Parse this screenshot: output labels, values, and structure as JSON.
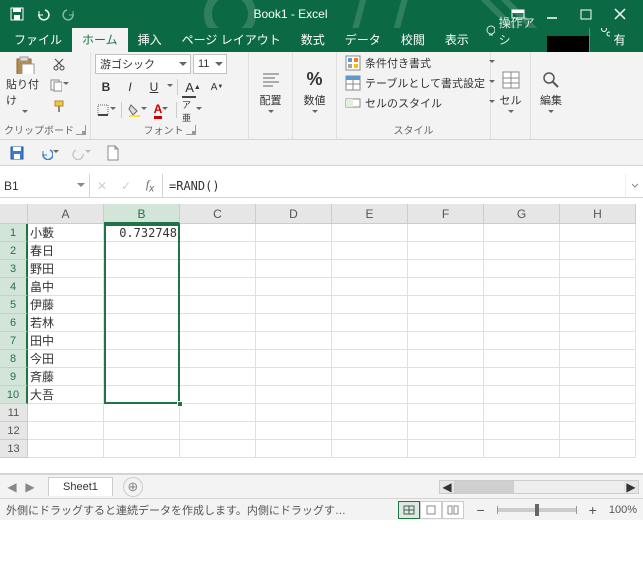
{
  "title": "Book1 - Excel",
  "tabs": {
    "file": "ファイル",
    "home": "ホーム",
    "insert": "挿入",
    "pagelayout": "ページ レイアウト",
    "formulas": "数式",
    "data": "データ",
    "review": "校閲",
    "view": "表示",
    "tellme": "操作アシ",
    "share": "共有"
  },
  "ribbon": {
    "clipboard": {
      "label": "クリップボード",
      "paste": "貼り付け"
    },
    "font": {
      "label": "フォント",
      "name": "游ゴシック",
      "size": "11",
      "bold": "B",
      "italic": "I",
      "underline": "U"
    },
    "alignment": {
      "label": "配置"
    },
    "number": {
      "label": "数値"
    },
    "styles": {
      "label": "スタイル",
      "conditional": "条件付き書式",
      "table": "テーブルとして書式設定",
      "cell": "セルのスタイル"
    },
    "cells": {
      "label": "セル"
    },
    "editing": {
      "label": "編集"
    }
  },
  "namebox": "B1",
  "formula": "=RAND()",
  "columns": [
    "A",
    "B",
    "C",
    "D",
    "E",
    "F",
    "G",
    "H"
  ],
  "rows": [
    "1",
    "2",
    "3",
    "4",
    "5",
    "6",
    "7",
    "8",
    "9",
    "10",
    "11",
    "12",
    "13"
  ],
  "selectedCol": "B",
  "selectedRows": [
    "1",
    "2",
    "3",
    "4",
    "5",
    "6",
    "7",
    "8",
    "9",
    "10"
  ],
  "colA": [
    "小藪",
    "春日",
    "野田",
    "畠中",
    "伊藤",
    "若林",
    "田中",
    "今田",
    "斉藤",
    "大吾"
  ],
  "b1": "0.732748",
  "sheet": {
    "name": "Sheet1"
  },
  "status": {
    "msg": "外側にドラッグすると連続データを作成します。内側にドラッグす…",
    "zoom": "100%"
  }
}
